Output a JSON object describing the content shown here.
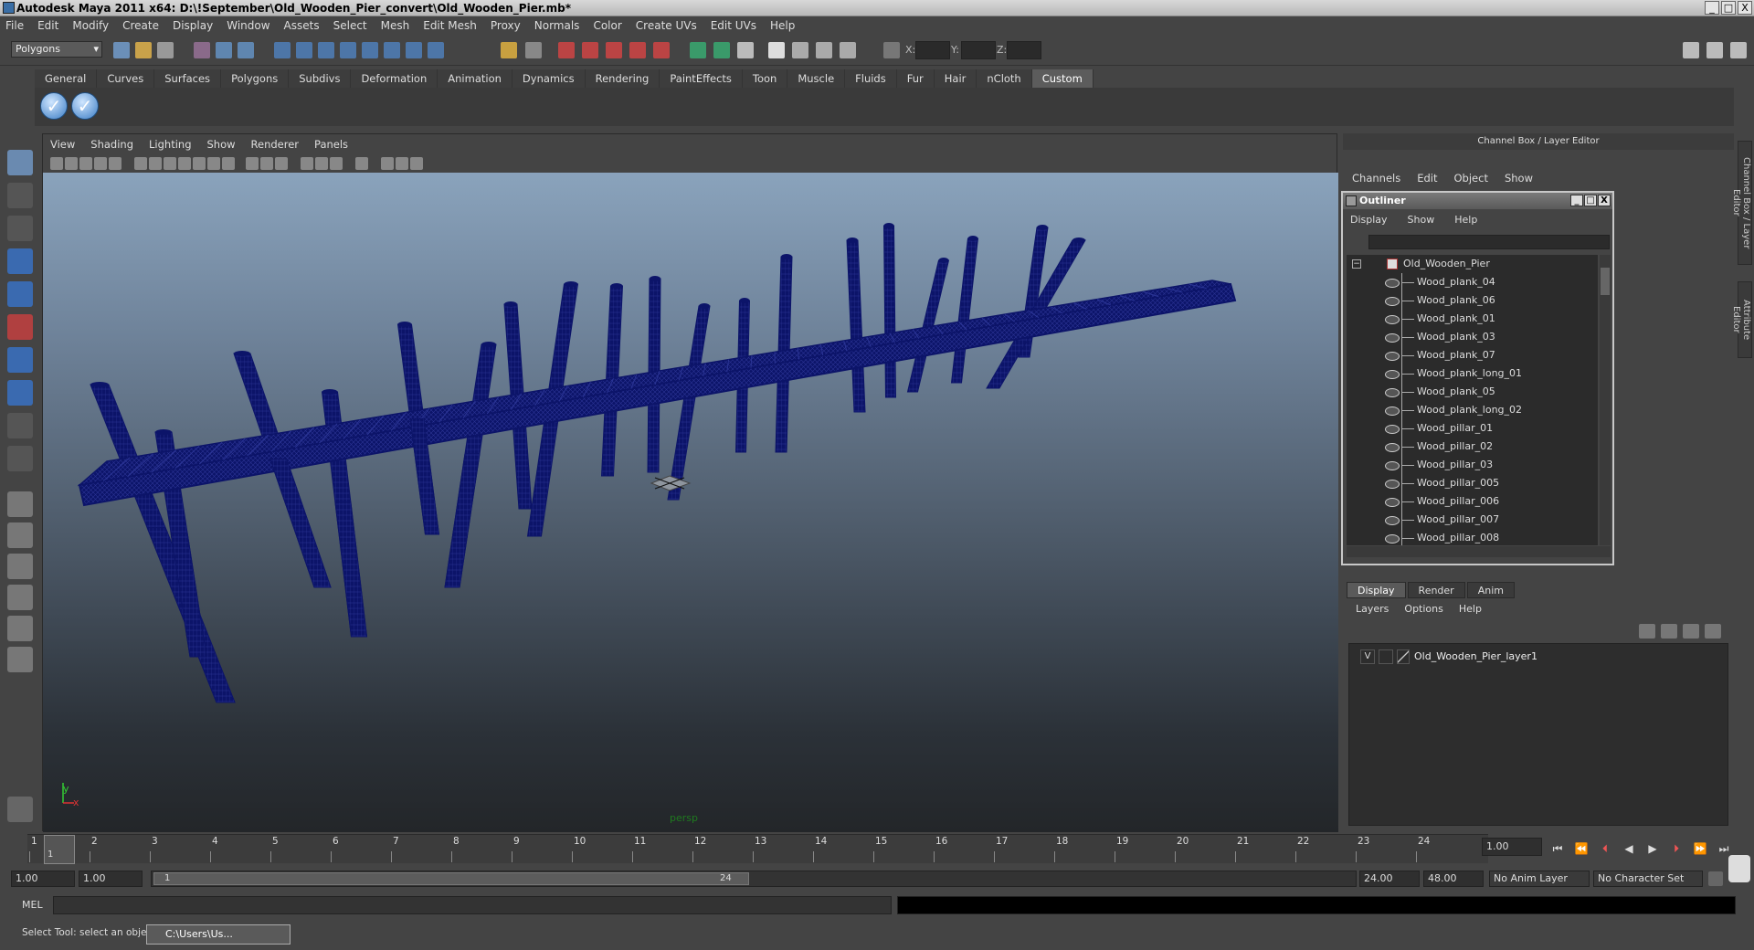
{
  "title": "Autodesk Maya 2011 x64: D:\\!September\\Old_Wooden_Pier_convert\\Old_Wooden_Pier.mb*",
  "window_buttons": [
    "_",
    "□",
    "X"
  ],
  "menu": [
    "File",
    "Edit",
    "Modify",
    "Create",
    "Display",
    "Window",
    "Assets",
    "Select",
    "Mesh",
    "Edit Mesh",
    "Proxy",
    "Normals",
    "Color",
    "Create UVs",
    "Edit UVs",
    "Help"
  ],
  "mode": "Polygons",
  "coord_labels": {
    "x": "X:",
    "y": "Y:",
    "z": "Z:"
  },
  "shelf_tabs": [
    "General",
    "Curves",
    "Surfaces",
    "Polygons",
    "Subdivs",
    "Deformation",
    "Animation",
    "Dynamics",
    "Rendering",
    "PaintEffects",
    "Toon",
    "Muscle",
    "Fluids",
    "Fur",
    "Hair",
    "nCloth",
    "Custom"
  ],
  "shelf_active": "Custom",
  "shelf_check": "✓",
  "viewport": {
    "menu": [
      "View",
      "Shading",
      "Lighting",
      "Show",
      "Renderer",
      "Panels"
    ],
    "camera_label": "persp",
    "axis_y": "y",
    "axis_x": "x",
    "wire_color": "#0c1469"
  },
  "channel_box": {
    "title": "Channel Box / Layer Editor",
    "menu": [
      "Channels",
      "Edit",
      "Object",
      "Show"
    ],
    "side_tab_1": "Channel Box / Layer Editor",
    "side_tab_2": "Attribute Editor"
  },
  "outliner": {
    "title": "Outliner",
    "menu": [
      "Display",
      "Show",
      "Help"
    ],
    "root": "Old_Wooden_Pier",
    "items": [
      "Wood_plank_04",
      "Wood_plank_06",
      "Wood_plank_01",
      "Wood_plank_03",
      "Wood_plank_07",
      "Wood_plank_long_01",
      "Wood_plank_05",
      "Wood_plank_long_02",
      "Wood_pillar_01",
      "Wood_pillar_02",
      "Wood_pillar_03",
      "Wood_pillar_005",
      "Wood_pillar_006",
      "Wood_pillar_007",
      "Wood_pillar_008"
    ]
  },
  "layer_editor": {
    "tabs": [
      "Display",
      "Render",
      "Anim"
    ],
    "active_tab": "Display",
    "menu": [
      "Layers",
      "Options",
      "Help"
    ],
    "layer_visible": "V",
    "layer_name": "Old_Wooden_Pier_layer1"
  },
  "timeline": {
    "frames": [
      "1",
      "2",
      "3",
      "4",
      "5",
      "6",
      "7",
      "8",
      "9",
      "10",
      "11",
      "12",
      "13",
      "14",
      "15",
      "16",
      "17",
      "18",
      "19",
      "20",
      "21",
      "22",
      "23",
      "24"
    ],
    "current_frame_marker": "1",
    "current_time": "1.00"
  },
  "range": {
    "start_time": "1.00",
    "playback_start": "1.00",
    "slider_start": "1",
    "slider_end": "24",
    "playback_end": "24.00",
    "end_time": "48.00",
    "anim_layer": "No Anim Layer",
    "character_set": "No Character Set"
  },
  "mel": {
    "label": "MEL"
  },
  "help_line": "Select Tool: select an object",
  "taskbar_item": "C:\\Users\\Us..."
}
